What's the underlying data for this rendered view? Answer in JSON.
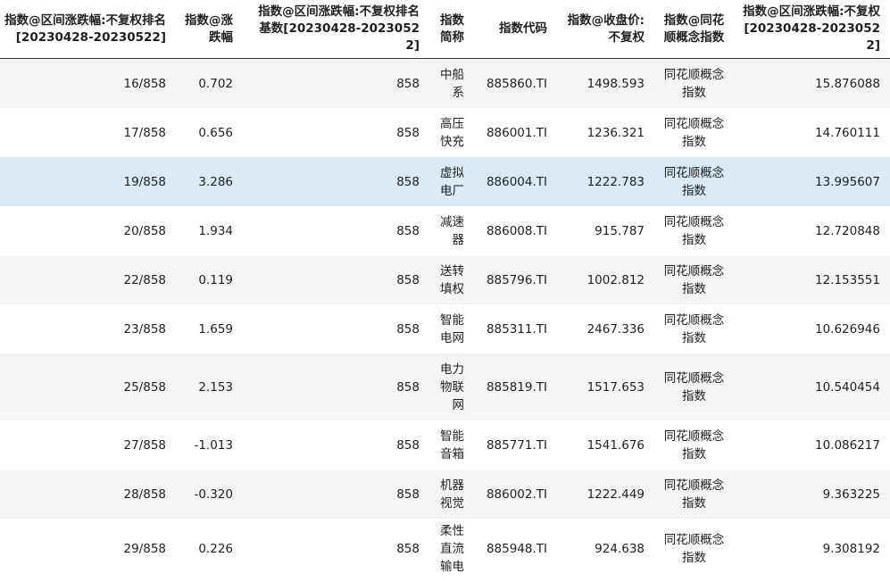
{
  "columns": [
    "指数@区间涨跌幅:不复权排名[20230428-20230522]",
    "指数@涨跌幅",
    "指数@区间涨跌幅:不复权排名基数[20230428-20230522]",
    "指数简称",
    "指数代码",
    "指数@收盘价:不复权",
    "指数@同花顺概念指数",
    "指数@区间涨跌幅:不复权[20230428-20230522]"
  ],
  "rows": [
    {
      "rank": "16/858",
      "change": "0.702",
      "base": "858",
      "name": "中船系",
      "code": "885860.TI",
      "close": "1498.593",
      "concept": "同花顺概念指数",
      "range_change": "15.876088"
    },
    {
      "rank": "17/858",
      "change": "0.656",
      "base": "858",
      "name": "高压快充",
      "code": "886001.TI",
      "close": "1236.321",
      "concept": "同花顺概念指数",
      "range_change": "14.760111"
    },
    {
      "rank": "19/858",
      "change": "3.286",
      "base": "858",
      "name": "虚拟电厂",
      "code": "886004.TI",
      "close": "1222.783",
      "concept": "同花顺概念指数",
      "range_change": "13.995607"
    },
    {
      "rank": "20/858",
      "change": "1.934",
      "base": "858",
      "name": "减速器",
      "code": "886008.TI",
      "close": "915.787",
      "concept": "同花顺概念指数",
      "range_change": "12.720848"
    },
    {
      "rank": "22/858",
      "change": "0.119",
      "base": "858",
      "name": "送转填权",
      "code": "885796.TI",
      "close": "1002.812",
      "concept": "同花顺概念指数",
      "range_change": "12.153551"
    },
    {
      "rank": "23/858",
      "change": "1.659",
      "base": "858",
      "name": "智能电网",
      "code": "885311.TI",
      "close": "2467.336",
      "concept": "同花顺概念指数",
      "range_change": "10.626946"
    },
    {
      "rank": "25/858",
      "change": "2.153",
      "base": "858",
      "name": "电力物联网",
      "code": "885819.TI",
      "close": "1517.653",
      "concept": "同花顺概念指数",
      "range_change": "10.540454"
    },
    {
      "rank": "27/858",
      "change": "-1.013",
      "base": "858",
      "name": "智能音箱",
      "code": "885771.TI",
      "close": "1541.676",
      "concept": "同花顺概念指数",
      "range_change": "10.086217"
    },
    {
      "rank": "28/858",
      "change": "-0.320",
      "base": "858",
      "name": "机器视觉",
      "code": "886002.TI",
      "close": "1222.449",
      "concept": "同花顺概念指数",
      "range_change": "9.363225"
    },
    {
      "rank": "29/858",
      "change": "0.226",
      "base": "858",
      "name": "柔性直流输电",
      "code": "885948.TI",
      "close": "924.638",
      "concept": "同花顺概念指数",
      "range_change": "9.308192"
    }
  ]
}
